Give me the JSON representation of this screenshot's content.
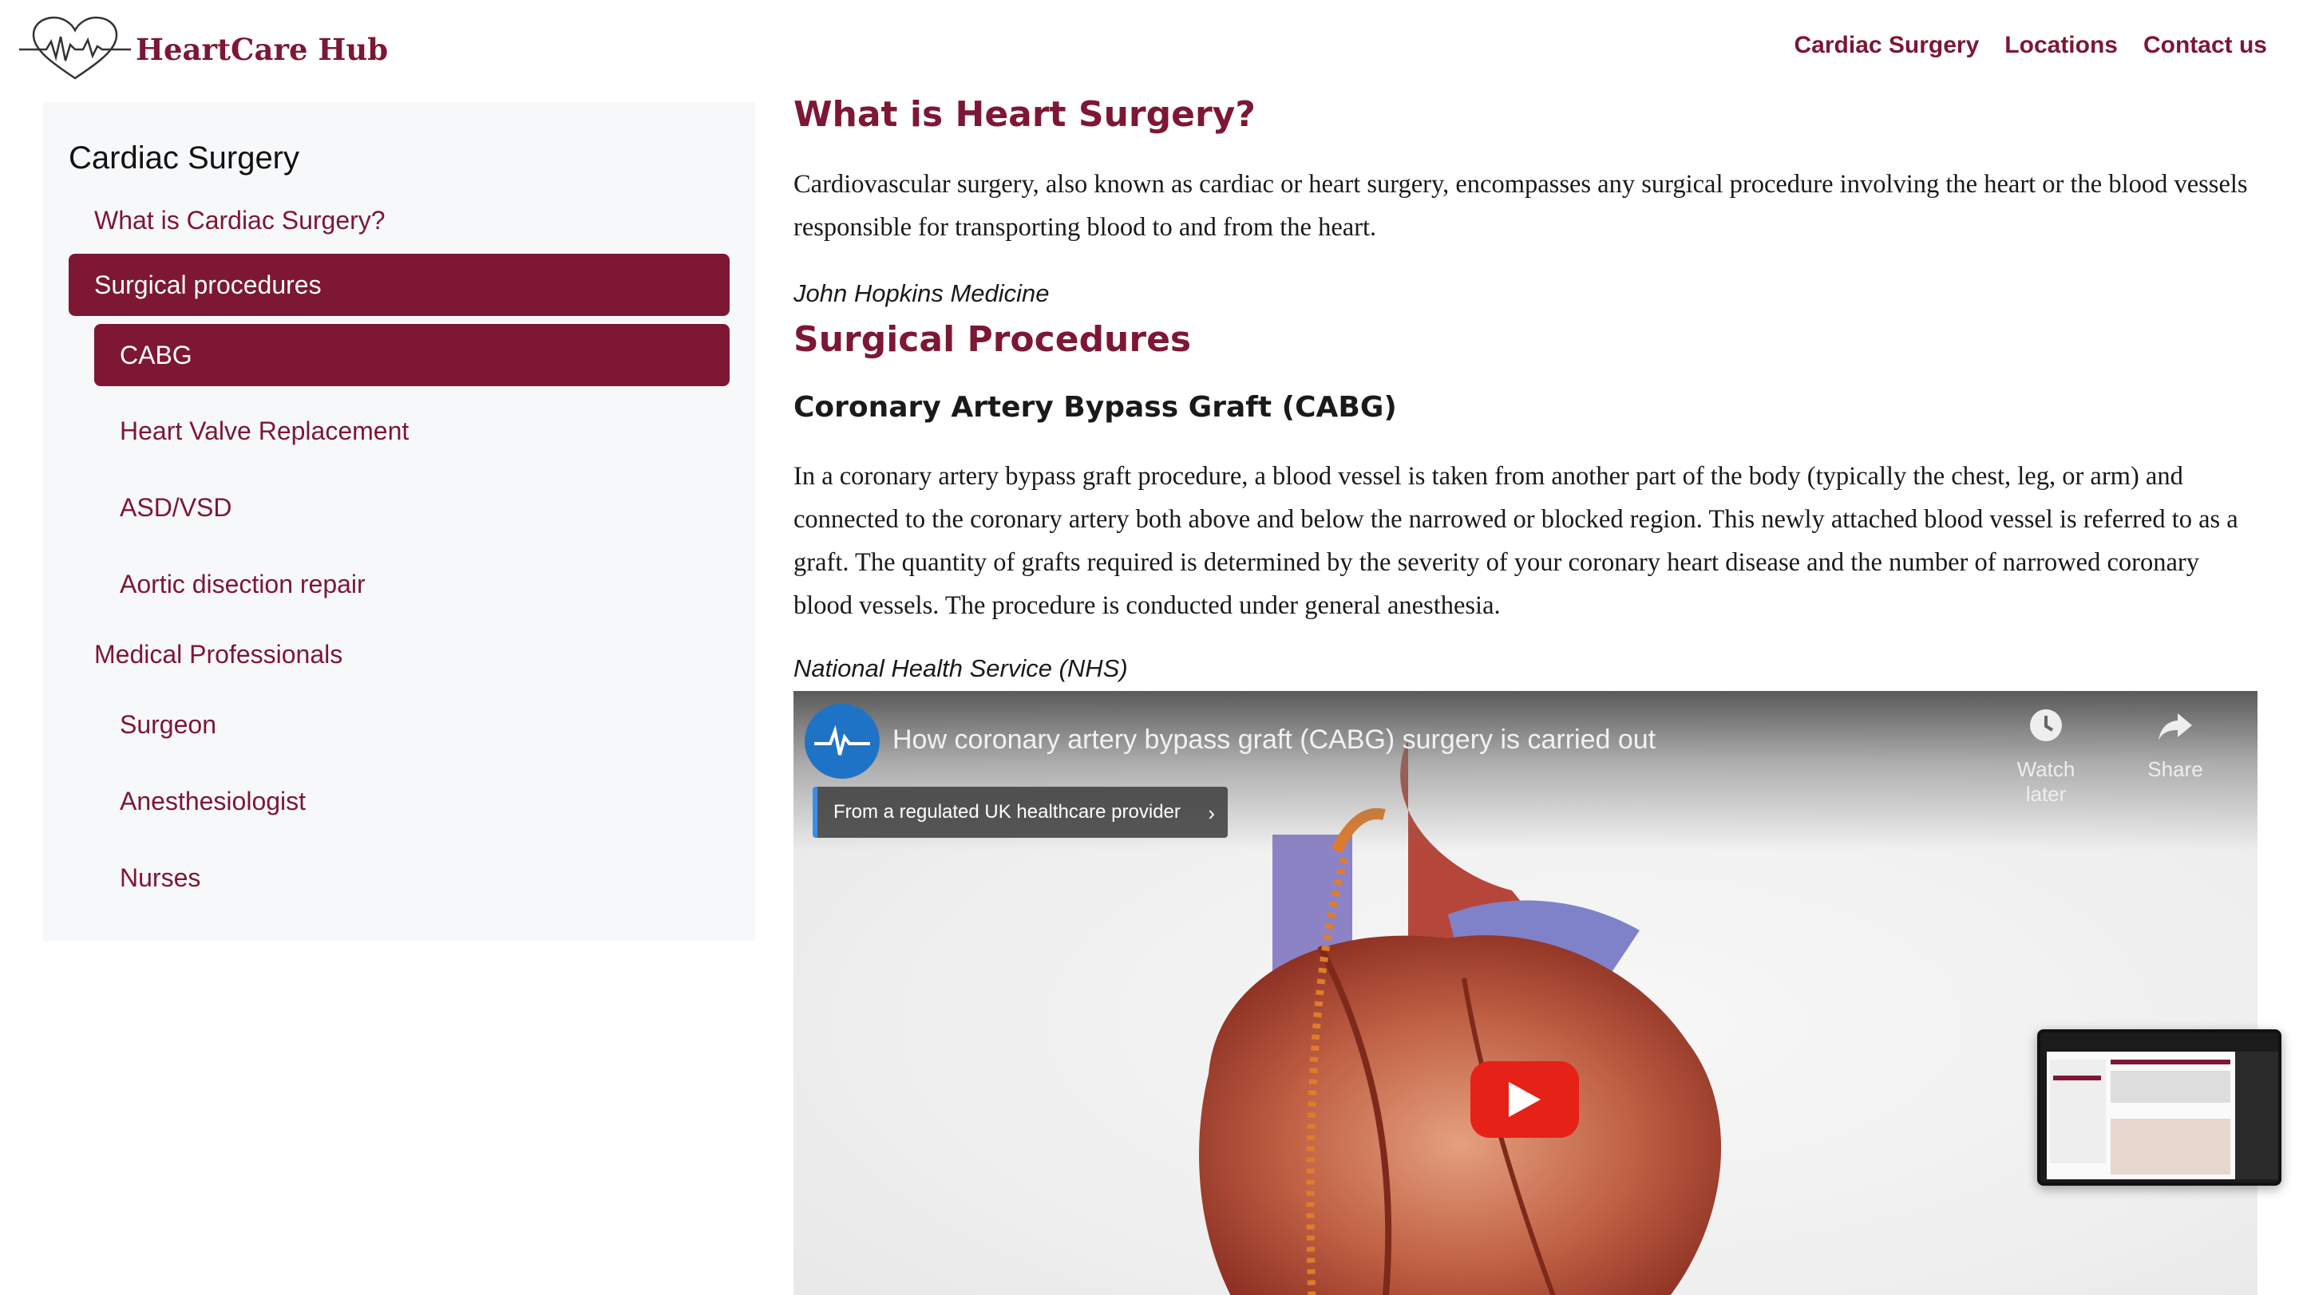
{
  "brand": {
    "name": "HeartCare Hub",
    "accent_color": "#7d1733"
  },
  "nav": {
    "items": [
      "Cardiac Surgery",
      "Locations",
      "Contact us"
    ]
  },
  "sidebar": {
    "title": "Cardiac Surgery",
    "items": [
      {
        "label": "What is Cardiac Surgery?",
        "active": false,
        "level": 1
      },
      {
        "label": "Surgical procedures",
        "active": true,
        "level": 1
      },
      {
        "label": "CABG",
        "active": true,
        "level": 2
      },
      {
        "label": "Heart Valve Replacement",
        "active": false,
        "level": 2
      },
      {
        "label": "ASD/VSD",
        "active": false,
        "level": 2
      },
      {
        "label": "Aortic disection repair",
        "active": false,
        "level": 2
      },
      {
        "label": "Medical Professionals",
        "active": false,
        "level": 1
      },
      {
        "label": "Surgeon",
        "active": false,
        "level": 2
      },
      {
        "label": "Anesthesiologist",
        "active": false,
        "level": 2
      },
      {
        "label": "Nurses",
        "active": false,
        "level": 2
      }
    ]
  },
  "main": {
    "heading1": "What is Heart Surgery?",
    "intro": "Cardiovascular surgery, also known as cardiac or heart surgery, encompasses any surgical procedure involving the heart or the blood vessels responsible for transporting blood to and from the heart.",
    "intro_source": "John Hopkins Medicine",
    "heading2": "Surgical Procedures",
    "subheading": "Coronary Artery Bypass Graft (CABG)",
    "cabg_text": "In a coronary artery bypass graft procedure, a blood vessel is taken from another part of the body (typically the chest, leg, or arm) and connected to the coronary artery both above and below the narrowed or blocked region. This newly attached blood vessel is referred to as a graft. The quantity of grafts required is determined by the severity of your coronary heart disease and the number of narrowed coronary blood vessels. The procedure is conducted under general anesthesia.",
    "cabg_source": "National Health Service (NHS)"
  },
  "video": {
    "title": "How coronary artery bypass graft (CABG) surgery is carried out",
    "watch_later": "Watch later",
    "share": "Share",
    "provider_note": "From a regulated UK healthcare provider",
    "play_color": "#e62117"
  }
}
